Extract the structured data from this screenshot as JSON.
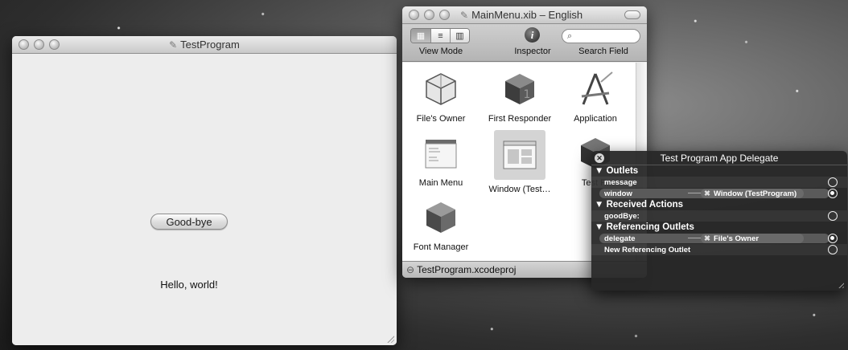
{
  "test_window": {
    "title": "TestProgram",
    "button_label": "Good-bye",
    "label_text": "Hello, world!"
  },
  "xib_window": {
    "title": "MainMenu.xib – English",
    "toolbar": {
      "view_mode_label": "View Mode",
      "inspector_label": "Inspector",
      "search_label": "Search Field",
      "search_placeholder": ""
    },
    "items": [
      {
        "label": "File's Owner",
        "icon": "cube-outline-icon"
      },
      {
        "label": "First Responder",
        "icon": "dark-cube-1-icon"
      },
      {
        "label": "Application",
        "icon": "application-a-icon"
      },
      {
        "label": "Main Menu",
        "icon": "menu-icon"
      },
      {
        "label": "Window (Test…",
        "icon": "window-icon"
      },
      {
        "label": "Test Pr",
        "icon": "dark-cube-icon"
      },
      {
        "label": "Font Manager",
        "icon": "font-cube-icon"
      }
    ],
    "status_text": "TestProgram.xcodeproj"
  },
  "hud": {
    "title": "Test Program App Delegate",
    "outlets_header": "▼ Outlets",
    "outlets": [
      {
        "name": "message",
        "target": ""
      },
      {
        "name": "window",
        "target": "Window (TestProgram)"
      }
    ],
    "actions_header": "▼ Received Actions",
    "actions": [
      {
        "name": "goodBye:"
      }
    ],
    "referencing_header": "▼ Referencing Outlets",
    "referencing": [
      {
        "name": "delegate",
        "target": "File's Owner"
      },
      {
        "name": "New Referencing Outlet"
      }
    ]
  }
}
